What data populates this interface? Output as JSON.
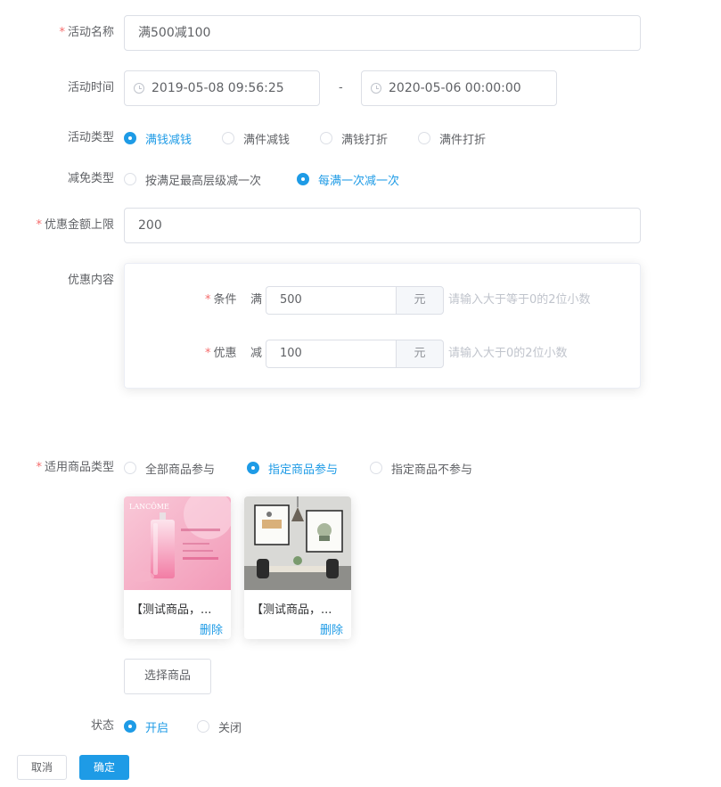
{
  "form": {
    "name": {
      "label": "活动名称",
      "value": "满500减100"
    },
    "time": {
      "label": "活动时间",
      "start": "2019-05-08 09:56:25",
      "separator": "-",
      "end": "2020-05-06 00:00:00"
    },
    "type": {
      "label": "活动类型",
      "options": [
        "满钱减钱",
        "满件减钱",
        "满钱打折",
        "满件打折"
      ],
      "selected": "满钱减钱"
    },
    "reduce_type": {
      "label": "减免类型",
      "options": [
        "按满足最高层级减一次",
        "每满一次减一次"
      ],
      "selected": "每满一次减一次"
    },
    "limit": {
      "label": "优惠金额上限",
      "value": "200"
    },
    "content": {
      "label": "优惠内容",
      "condition": {
        "label": "条件",
        "prefix": "满",
        "value": "500",
        "unit": "元",
        "hint": "请输入大于等于0的2位小数"
      },
      "discount": {
        "label": "优惠",
        "prefix": "减",
        "value": "100",
        "unit": "元",
        "hint": "请输入大于0的2位小数"
      }
    },
    "goods_type": {
      "label": "适用商品类型",
      "options": [
        "全部商品参与",
        "指定商品参与",
        "指定商品不参与"
      ],
      "selected": "指定商品参与"
    },
    "products": [
      {
        "title": "【测试商品，...",
        "delete_label": "删除",
        "image_brand": "LANCÔME"
      },
      {
        "title": "【测试商品，...",
        "delete_label": "删除"
      }
    ],
    "select_goods_label": "选择商品",
    "status": {
      "label": "状态",
      "options": [
        "开启",
        "关闭"
      ],
      "selected": "开启"
    }
  },
  "footer": {
    "cancel_label": "取消",
    "confirm_label": "确定"
  },
  "colors": {
    "primary": "#1e9be6",
    "required": "#f56c6c",
    "border": "#dcdfe6",
    "text": "#606266",
    "placeholder": "#c0c4cc"
  }
}
